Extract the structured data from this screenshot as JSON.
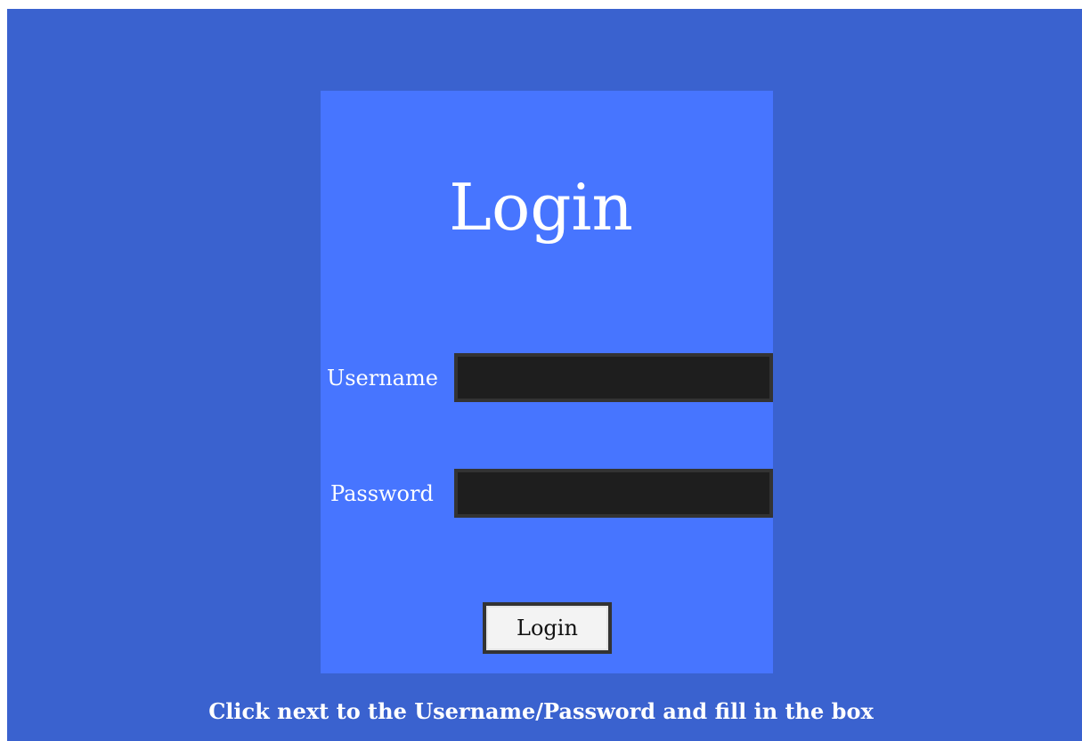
{
  "app": {
    "title": "Login"
  },
  "form": {
    "title": "Login",
    "username": {
      "label": "Username",
      "value": "",
      "placeholder": ""
    },
    "password": {
      "label": "Password",
      "value": "",
      "placeholder": ""
    },
    "submit_label": "Login"
  },
  "instruction": "Click next to the Username/Password and fill in the box",
  "colors": {
    "page_background": "#3a62cf",
    "panel_background": "#4775ff",
    "input_background": "#1e1e1e",
    "input_border": "#333333",
    "button_background": "#f3f3f3",
    "text_light": "#ffffff"
  }
}
